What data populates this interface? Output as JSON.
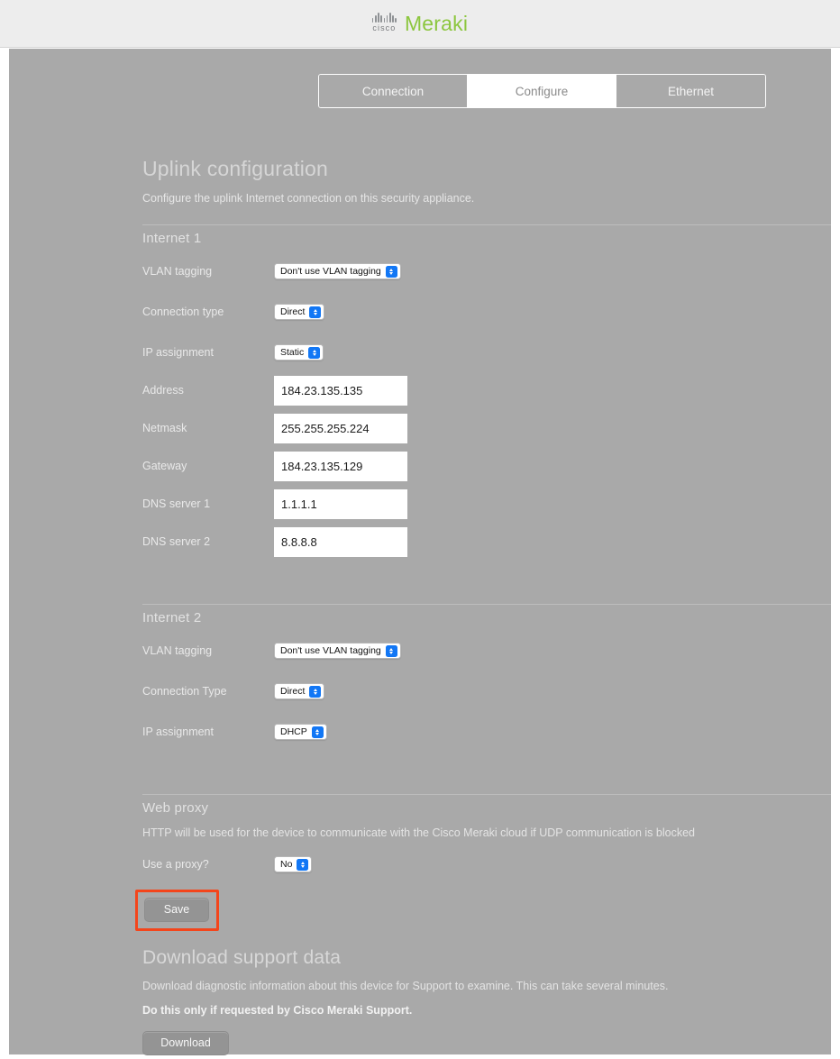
{
  "header": {
    "cisco_wordmark": "cisco",
    "brand_name": "Meraki",
    "brand_color": "#8cc63e"
  },
  "tabs": [
    {
      "label": "Connection",
      "active": false
    },
    {
      "label": "Configure",
      "active": true
    },
    {
      "label": "Ethernet",
      "active": false
    }
  ],
  "uplink": {
    "title": "Uplink configuration",
    "description": "Configure the uplink Internet connection on this security appliance."
  },
  "internet1": {
    "section_title": "Internet 1",
    "vlan_tagging_label": "VLAN tagging",
    "vlan_tagging_value": "Don't use VLAN tagging",
    "connection_type_label": "Connection type",
    "connection_type_value": "Direct",
    "ip_assignment_label": "IP assignment",
    "ip_assignment_value": "Static",
    "address_label": "Address",
    "address_value": "184.23.135.135",
    "netmask_label": "Netmask",
    "netmask_value": "255.255.255.224",
    "gateway_label": "Gateway",
    "gateway_value": "184.23.135.129",
    "dns1_label": "DNS server 1",
    "dns1_value": "1.1.1.1",
    "dns2_label": "DNS server 2",
    "dns2_value": "8.8.8.8"
  },
  "internet2": {
    "section_title": "Internet 2",
    "vlan_tagging_label": "VLAN tagging",
    "vlan_tagging_value": "Don't use VLAN tagging",
    "connection_type_label": "Connection Type",
    "connection_type_value": "Direct",
    "ip_assignment_label": "IP assignment",
    "ip_assignment_value": "DHCP"
  },
  "web_proxy": {
    "section_title": "Web proxy",
    "description": "HTTP will be used for the device to communicate with the Cisco Meraki cloud if UDP communication is blocked",
    "use_proxy_label": "Use a proxy?",
    "use_proxy_value": "No"
  },
  "actions": {
    "save_label": "Save",
    "save_highlight_color": "#f4451b"
  },
  "download_support": {
    "title": "Download support data",
    "description": "Download diagnostic information about this device for Support to examine. This can take several minutes.",
    "warning": "Do this only if requested by Cisco Meraki Support.",
    "button_label": "Download"
  }
}
